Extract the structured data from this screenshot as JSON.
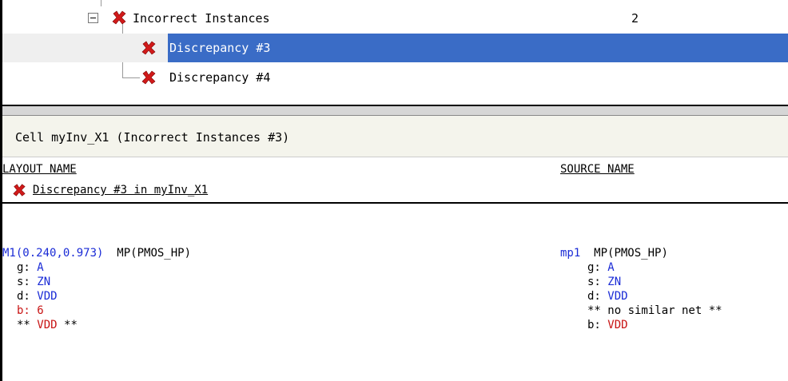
{
  "tree": {
    "group": {
      "label": "Incorrect Instances",
      "count": "2"
    },
    "items": [
      {
        "label": "Discrepancy #3",
        "selected": true
      },
      {
        "label": "Discrepancy #4",
        "selected": false
      }
    ]
  },
  "detail": {
    "title": "Cell myInv_X1 (Incorrect Instances #3)",
    "columns": {
      "layout": "LAYOUT NAME",
      "source": "SOURCE NAME"
    },
    "discrepancy_label": "Discrepancy #3 in myInv_X1",
    "layout": {
      "instance": "M1(0.240,0.973)",
      "type": "MP(PMOS_HP)",
      "pins": [
        {
          "name": "g:",
          "value": "A",
          "value_color": "blue"
        },
        {
          "name": "s:",
          "value": "ZN",
          "value_color": "blue"
        },
        {
          "name": "d:",
          "value": "VDD",
          "value_color": "blue"
        },
        {
          "name": "b:",
          "value": "6",
          "value_color": "red"
        }
      ],
      "note_prefix": "**",
      "note_value": "VDD",
      "note_suffix": "**"
    },
    "source": {
      "instance": "mp1",
      "type": "MP(PMOS_HP)",
      "pins": [
        {
          "name": "g:",
          "value": "A",
          "value_color": "blue"
        },
        {
          "name": "s:",
          "value": "ZN",
          "value_color": "blue"
        },
        {
          "name": "d:",
          "value": "VDD",
          "value_color": "blue"
        }
      ],
      "note": "** no similar net **",
      "last_pin": {
        "name": "b:",
        "value": "VDD",
        "value_color": "red"
      }
    }
  },
  "colors": {
    "selection": "#3a6cc6",
    "net_blue": "#1a2bd6",
    "net_red": "#c81414",
    "error_icon": "#d11a1a"
  },
  "icons": {
    "error": "x-error-icon",
    "collapse": "minus-box-icon"
  }
}
